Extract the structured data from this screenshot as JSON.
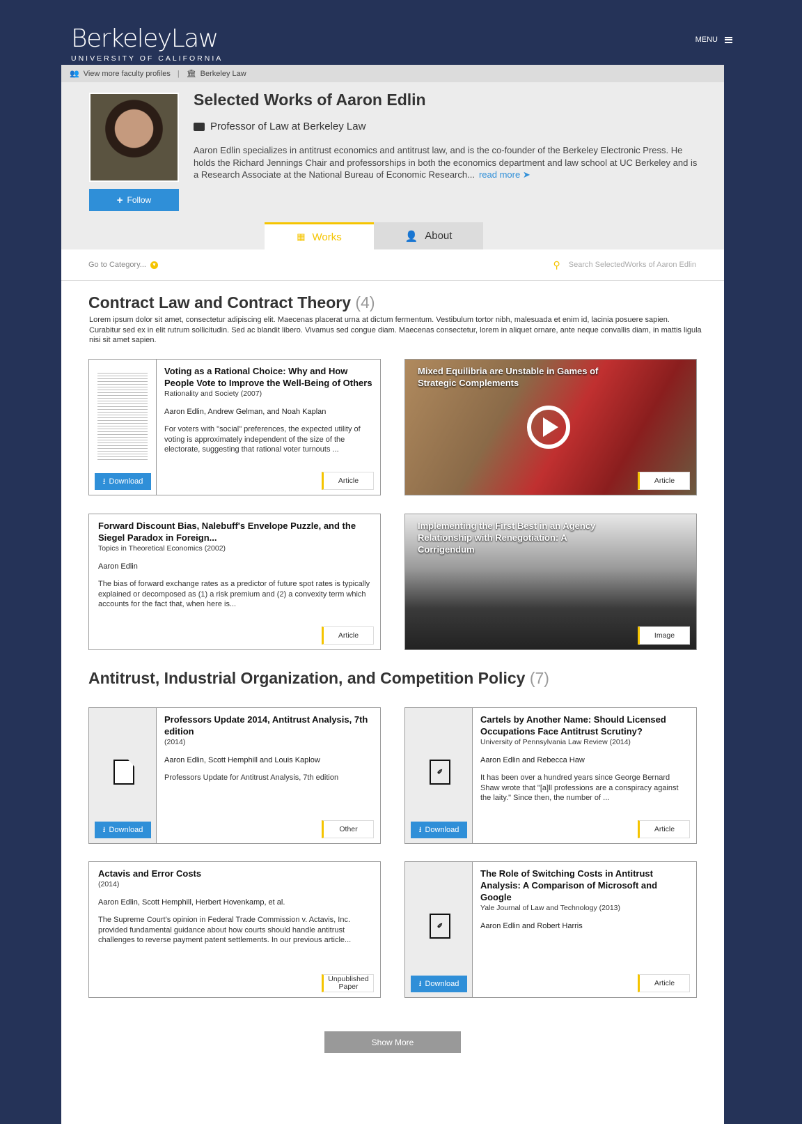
{
  "header": {
    "logo_main": "BerkeleyLaw",
    "logo_sub": "UNIVERSITY OF CALIFORNIA",
    "menu_label": "MENU"
  },
  "breadcrumb": {
    "faculty_link": "View more faculty profiles",
    "separator": "|",
    "school_link": "Berkeley Law"
  },
  "profile": {
    "name": "Selected Works of Aaron Edlin",
    "title": "Professor of Law at Berkeley Law",
    "bio": "Aaron Edlin specializes in antitrust economics and antitrust law, and is the co-founder of the Berkeley Electronic Press. He holds the Richard Jennings Chair and professorships in both the economics department and law school at UC Berkeley and is a Research Associate at the National Bureau of Economic Research...",
    "read_more": "read more",
    "follow_label": "Follow"
  },
  "tabs": [
    {
      "label": "Works",
      "active": true
    },
    {
      "label": "About",
      "active": false
    }
  ],
  "filter": {
    "category_label": "Go to Category...",
    "search_placeholder": "Search SelectedWorks of Aaron Edlin"
  },
  "colors": {
    "background": "#253358",
    "accent": "#f5c400",
    "link": "#2f8fd8"
  },
  "sections": [
    {
      "title": "Contract Law and Contract Theory",
      "count": "(4)",
      "description": "Lorem ipsum dolor sit amet, consectetur adipiscing elit. Maecenas placerat urna at dictum fermentum. Vestibulum tortor nibh, malesuada et enim id, lacinia posuere sapien. Curabitur sed ex in elit rutrum sollicitudin. Sed ac blandit libero. Vivamus sed congue diam. Maecenas consectetur, lorem in aliquet ornare, ante neque convallis diam, in mattis ligula nisi sit amet sapien.",
      "works": [
        {
          "kind": "doc",
          "title": "Voting as a Rational Choice: Why and How People Vote to Improve the Well-Being of Others",
          "venue": "Rationality and Society (2007)",
          "authors": "Aaron Edlin, Andrew Gelman, and Noah Kaplan",
          "desc": "For voters with \"social\" preferences, the expected utility of voting is approximately independent of the size of the electorate, suggesting that rational voter turnouts ...",
          "type": "Article",
          "download": "Download"
        },
        {
          "kind": "video",
          "title": "Mixed Equilibria are Unstable in Games of Strategic Complements",
          "type": "Article"
        },
        {
          "kind": "text",
          "title": "Forward Discount Bias, Nalebuff's Envelope Puzzle, and the Siegel Paradox in Foreign...",
          "venue": "Topics in Theoretical Economics (2002)",
          "authors": "Aaron Edlin",
          "desc": "The bias of forward exchange rates as a predictor of future spot rates is typically explained or decomposed as (1) a risk premium and (2) a convexity term which accounts for the fact that, when here is...",
          "type": "Article"
        },
        {
          "kind": "image",
          "title": "Implementing the First Best in an Agency Relationship with Renegotiation: A Corrigendum",
          "type": "Image"
        }
      ]
    },
    {
      "title": "Antitrust, Industrial Organization, and Competition Policy",
      "count": "(7)",
      "works": [
        {
          "kind": "file",
          "title": "Professors Update 2014, Antitrust Analysis, 7th edition",
          "venue": "(2014)",
          "authors": "Aaron Edlin, Scott Hemphill and Louis Kaplow",
          "desc": "Professors Update for Antitrust Analysis, 7th edition",
          "type": "Other",
          "download": "Download"
        },
        {
          "kind": "pdf",
          "title": "Cartels by Another Name: Should Licensed Occupations Face Antitrust Scrutiny?",
          "venue": "University of Pennsylvania Law Review (2014)",
          "authors": "Aaron Edlin and Rebecca Haw",
          "desc": "It has been over a hundred years since George Bernard Shaw wrote that \"[a]ll professions are a conspiracy against the laity.\" Since then, the number of ...",
          "type": "Article",
          "download": "Download"
        },
        {
          "kind": "text",
          "title": "Actavis and Error Costs",
          "venue": "(2014)",
          "authors": "Aaron Edlin, Scott Hemphill, Herbert Hovenkamp, et al.",
          "desc": "The Supreme Court's opinion in Federal Trade Commission v. Actavis, Inc. provided fundamental guidance about how courts should handle antitrust challenges to reverse payment patent settlements. In our previous article...",
          "type": "Unpublished Paper"
        },
        {
          "kind": "pdf",
          "title": "The Role of Switching Costs in Antitrust Analysis: A Comparison of Microsoft and Google",
          "venue": "Yale Journal of Law and Technology (2013)",
          "authors": "Aaron Edlin and Robert Harris",
          "desc": "",
          "type": "Article",
          "download": "Download"
        }
      ]
    }
  ],
  "show_more": "Show More"
}
